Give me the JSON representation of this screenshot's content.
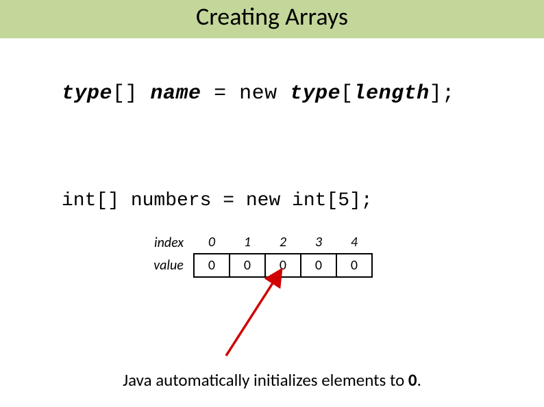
{
  "title": "Creating Arrays",
  "syntax": {
    "type1": "type",
    "brackets1": "[]",
    "name": "name",
    "equals": "=",
    "newkw": "new",
    "type2": "type",
    "open": "[",
    "length": "length",
    "close": "];"
  },
  "example": "int[] numbers = new int[5];",
  "table": {
    "index_label": "index",
    "value_label": "value",
    "indices": [
      "0",
      "1",
      "2",
      "3",
      "4"
    ],
    "values": [
      "0",
      "0",
      "0",
      "0",
      "0"
    ]
  },
  "footer": {
    "pre": "Java automatically initializes elements to ",
    "zero": "0",
    "post": "."
  },
  "chart_data": {
    "type": "table",
    "title": "Array default initialization (int[5])",
    "columns": [
      "index",
      "value"
    ],
    "rows": [
      {
        "index": 0,
        "value": 0
      },
      {
        "index": 1,
        "value": 0
      },
      {
        "index": 2,
        "value": 0
      },
      {
        "index": 3,
        "value": 0
      },
      {
        "index": 4,
        "value": 0
      }
    ]
  }
}
